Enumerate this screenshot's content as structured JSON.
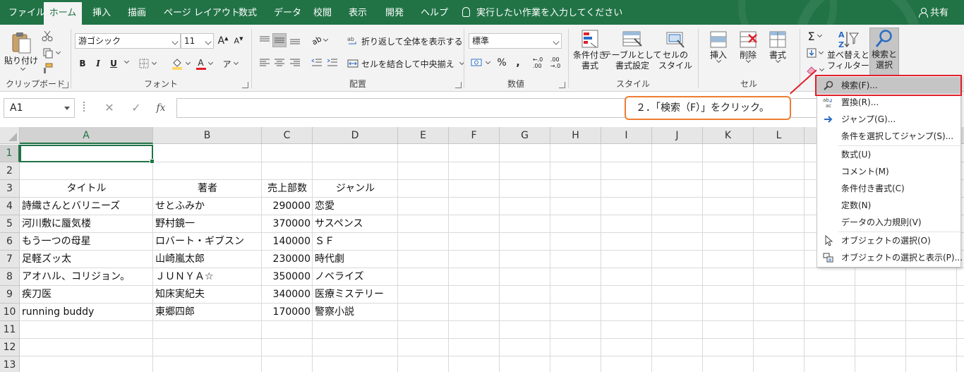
{
  "tabs": {
    "file": "ファイル",
    "home": "ホーム",
    "insert": "挿入",
    "draw": "描画",
    "page_layout": "ページ レイアウト",
    "formulas": "数式",
    "data": "データ",
    "review": "校閲",
    "view": "表示",
    "developer": "開発",
    "help": "ヘルプ"
  },
  "tell_me": "実行したい作業を入力してください",
  "share": "共有",
  "ribbon": {
    "clipboard": {
      "paste": "貼り付け",
      "label": "クリップボード"
    },
    "font": {
      "name": "游ゴシック",
      "size": "11",
      "bold": "B",
      "italic": "I",
      "underline": "U",
      "label": "フォント",
      "font_color": "#e0202b",
      "fill_color": "#ffd966"
    },
    "alignment": {
      "wrap_text": "折り返して全体を表示する",
      "merge_center": "セルを結合して中央揃え",
      "label": "配置"
    },
    "number": {
      "format": "標準",
      "percent": "%",
      "label": "数値"
    },
    "styles": {
      "conditional_line1": "条件付き",
      "conditional_line2": "書式",
      "table_line1": "テーブルとして",
      "table_line2": "書式設定",
      "cell_line1": "セルの",
      "cell_line2": "スタイル",
      "label": "スタイル"
    },
    "cells": {
      "insert": "挿入",
      "delete": "削除",
      "format": "書式",
      "label": "セル"
    },
    "editing": {
      "sort_line1": "並べ替えと",
      "sort_line2": "フィルター",
      "find_line1": "検索と",
      "find_line2": "選択"
    }
  },
  "formula_bar": {
    "name_box": "A1",
    "fx": "fx",
    "value": ""
  },
  "columns": [
    "A",
    "B",
    "C",
    "D",
    "E",
    "F",
    "G",
    "H",
    "I",
    "J",
    "K",
    "L"
  ],
  "rows": [
    {
      "n": "1",
      "a": "",
      "b": "",
      "c": "",
      "d": ""
    },
    {
      "n": "2",
      "a": "",
      "b": "",
      "c": "",
      "d": ""
    },
    {
      "n": "3",
      "a": "タイトル",
      "b": "著者",
      "c": "売上部数",
      "d": "ジャンル"
    },
    {
      "n": "4",
      "a": "詩織さんとバリニーズ",
      "b": "せとふみか",
      "c": "290000",
      "d": "恋愛"
    },
    {
      "n": "5",
      "a": "河川敷に蜃気楼",
      "b": "野村鏡一",
      "c": "370000",
      "d": "サスペンス"
    },
    {
      "n": "6",
      "a": "もう一つの母星",
      "b": "ロバート・ギブスン",
      "c": "140000",
      "d": "ＳＦ"
    },
    {
      "n": "7",
      "a": "足軽ズッ太",
      "b": "山崎嵐太郎",
      "c": "230000",
      "d": "時代劇"
    },
    {
      "n": "8",
      "a": "アオハル、コリジョン。",
      "b": "ＪＵＮＹＡ☆",
      "c": "350000",
      "d": "ノベライズ"
    },
    {
      "n": "9",
      "a": "疾刀医",
      "b": "知床実紀夫",
      "c": "340000",
      "d": "医療ミステリー"
    },
    {
      "n": "10",
      "a": "running buddy",
      "b": "東郷四郎",
      "c": "170000",
      "d": "警察小説"
    },
    {
      "n": "11",
      "a": "",
      "b": "",
      "c": "",
      "d": ""
    },
    {
      "n": "12",
      "a": "",
      "b": "",
      "c": "",
      "d": ""
    },
    {
      "n": "13",
      "a": "",
      "b": "",
      "c": "",
      "d": ""
    }
  ],
  "menu": {
    "find": "検索(F)...",
    "replace": "置換(R)...",
    "goto": "ジャンプ(G)...",
    "goto_special": "条件を選択してジャンプ(S)...",
    "formulas": "数式(U)",
    "comments": "コメント(M)",
    "conditional_formatting": "条件付き書式(C)",
    "constants": "定数(N)",
    "data_validation": "データの入力規則(V)",
    "select_objects": "オブジェクトの選択(O)",
    "selection_pane": "オブジェクトの選択と表示(P)..."
  },
  "callout": "２．「検索（F）」をクリック。",
  "colors": {
    "excel_green": "#217346",
    "highlight_red": "#e0202b",
    "callout_orange": "#ed7d31"
  }
}
